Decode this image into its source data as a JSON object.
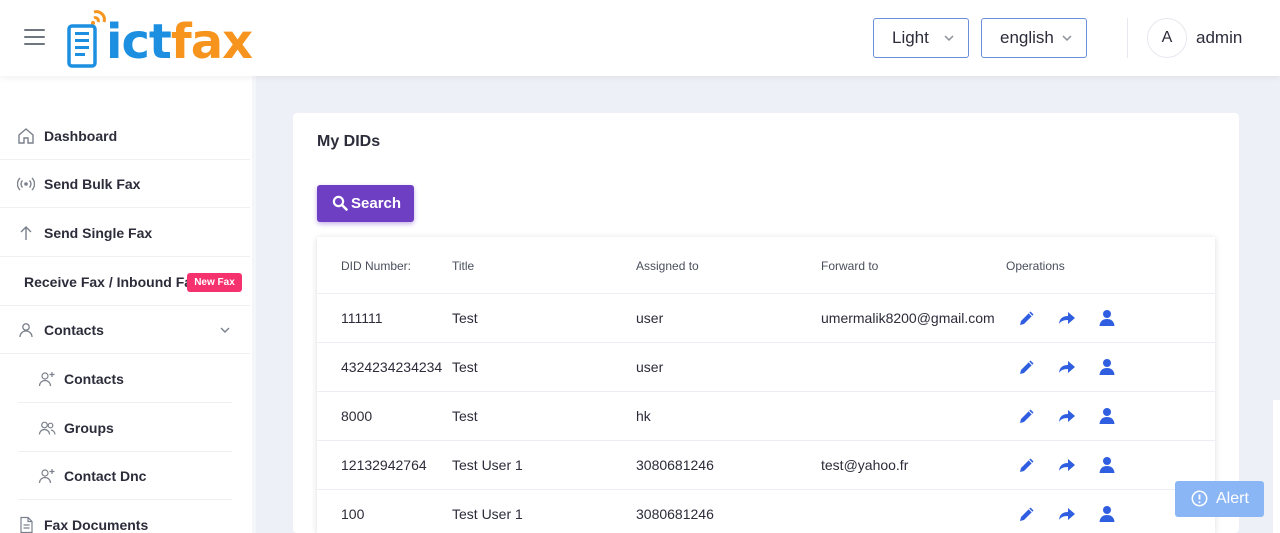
{
  "header": {
    "logo": {
      "part1": "ict",
      "part2": "fax",
      "icon": "fax-document-wifi-icon"
    },
    "theme_select": {
      "value": "Light"
    },
    "language_select": {
      "value": "english"
    },
    "user": {
      "avatar_initial": "A",
      "name": "admin"
    }
  },
  "sidebar": {
    "items": [
      {
        "label": "Dashboard",
        "icon": "home-icon"
      },
      {
        "label": "Send Bulk Fax",
        "icon": "broadcast-icon"
      },
      {
        "label": "Send Single Fax",
        "icon": "arrow-up-icon"
      },
      {
        "label": "Receive Fax / Inbound Fax",
        "badge": "New Fax"
      },
      {
        "label": "Contacts",
        "icon": "user-icon",
        "expanded": true
      }
    ],
    "contacts_sub": [
      {
        "label": "Contacts",
        "icon": "user-plus-icon"
      },
      {
        "label": "Groups",
        "icon": "users-icon"
      },
      {
        "label": "Contact Dnc",
        "icon": "user-plus-icon"
      }
    ],
    "after": [
      {
        "label": "Fax Documents",
        "icon": "document-icon"
      }
    ]
  },
  "main": {
    "title": "My DIDs",
    "search_button": "Search",
    "table": {
      "headers": [
        "DID Number:",
        "Title",
        "Assigned to",
        "Forward to",
        "Operations"
      ],
      "rows": [
        [
          "111111",
          "Test",
          "user",
          "umermalik8200@gmail.com"
        ],
        [
          "4324234234234",
          "Test",
          "user",
          ""
        ],
        [
          "8000",
          "Test",
          "hk",
          ""
        ],
        [
          "12132942764",
          "Test User 1",
          "3080681246",
          "test@yahoo.fr"
        ],
        [
          "100",
          "Test User 1",
          "3080681246",
          ""
        ]
      ],
      "operations": [
        "edit-icon",
        "forward-icon",
        "assign-user-icon"
      ]
    }
  },
  "alert_button": "Alert",
  "colors": {
    "primary_purple": "#6e3fc3",
    "logo_blue": "#1c8fe0",
    "logo_orange": "#f7941d",
    "badge_pink": "#f5316e",
    "operation_icon_blue": "#2f5fe0",
    "alert_bg": "#8ab6f6"
  }
}
